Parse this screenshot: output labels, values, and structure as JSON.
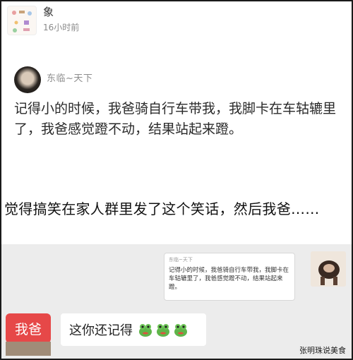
{
  "post": {
    "name": "象",
    "time": "16小时前"
  },
  "quote": {
    "name": "东临~天下",
    "text": "记得小的时候，我爸骑自行车带我，我脚卡在车轱辘里了，我爸感觉蹬不动，结果站起来蹬。"
  },
  "caption": "觉得搞笑在家人群里发了这个笑话，然后我爸……",
  "chat": {
    "forward_name": "东临~天下",
    "forward_text": "记得小的时候，我爸骑自行车带我，我脚卡在车轱辘里了，我爸感觉蹬不动，结果站起来蹬。",
    "dad_label": "我爸",
    "reply_text": "这你还记得",
    "reply_emoji": [
      "frog-emoji",
      "frog-emoji",
      "frog-emoji"
    ]
  },
  "watermark": "张明珠说美食",
  "colors": {
    "dad_badge": "#e64848",
    "chat_bg": "#ececec",
    "caption_text": "#111111"
  }
}
